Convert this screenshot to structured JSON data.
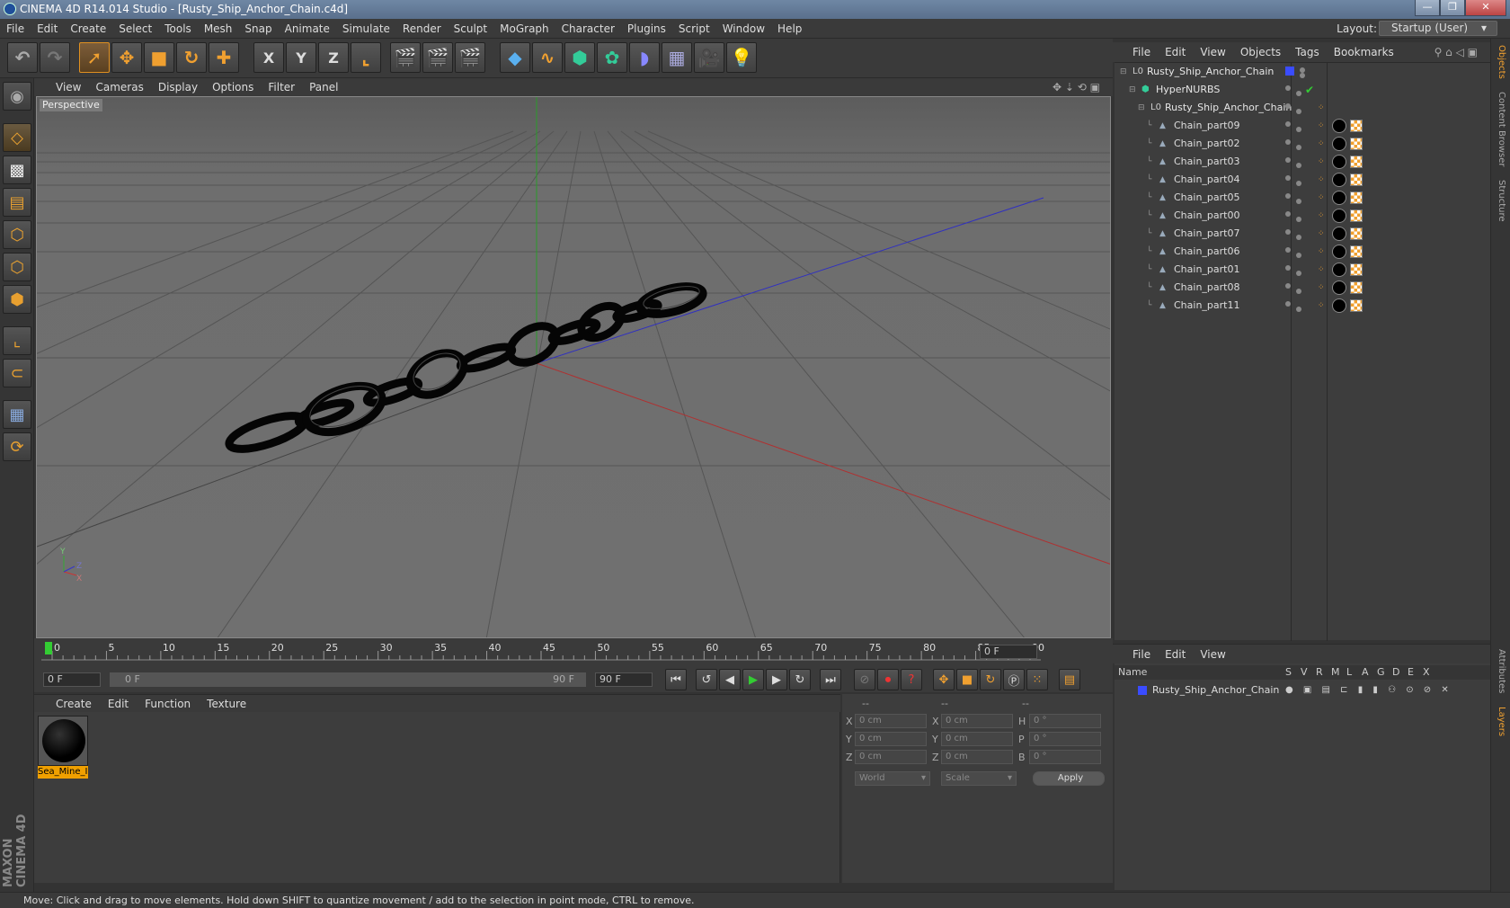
{
  "window": {
    "title": "CINEMA 4D R14.014 Studio - [Rusty_Ship_Anchor_Chain.c4d]",
    "buttons": [
      "—",
      "❐",
      "✕"
    ]
  },
  "menubar": {
    "items": [
      "File",
      "Edit",
      "Create",
      "Select",
      "Tools",
      "Mesh",
      "Snap",
      "Animate",
      "Simulate",
      "Render",
      "Sculpt",
      "MoGraph",
      "Character",
      "Plugins",
      "Script",
      "Window",
      "Help"
    ],
    "layout_label": "Layout:",
    "layout_value": "Startup (User)"
  },
  "toolbar": {
    "axis_x": "X",
    "axis_y": "Y",
    "axis_z": "Z"
  },
  "viewport": {
    "menu": [
      "View",
      "Cameras",
      "Display",
      "Options",
      "Filter",
      "Panel"
    ],
    "label": "Perspective",
    "axis_y": "Y",
    "axis_z": "Z",
    "axis_x": "X"
  },
  "timeline": {
    "ticks": [
      "0",
      "5",
      "10",
      "15",
      "20",
      "25",
      "30",
      "35",
      "40",
      "45",
      "50",
      "55",
      "60",
      "65",
      "70",
      "75",
      "80",
      "85",
      "90"
    ],
    "current_frame": "0 F",
    "start_frame": "0 F",
    "range_start": "0 F",
    "range_end": "90 F",
    "end_frame": "90 F"
  },
  "materials": {
    "menu": [
      "Create",
      "Edit",
      "Function",
      "Texture"
    ],
    "items": [
      {
        "name": "Sea_Mine_I"
      }
    ]
  },
  "coordinates": {
    "headers": [
      "--",
      "--",
      "--"
    ],
    "labels_pos": [
      "X",
      "Y",
      "Z"
    ],
    "labels_size": [
      "X",
      "Y",
      "Z"
    ],
    "labels_rot": [
      "H",
      "P",
      "B"
    ],
    "pos": [
      "0 cm",
      "0 cm",
      "0 cm"
    ],
    "size": [
      "0 cm",
      "0 cm",
      "0 cm"
    ],
    "rot": [
      "0 °",
      "0 °",
      "0 °"
    ],
    "mode": "World",
    "scale": "Scale",
    "apply": "Apply"
  },
  "objects": {
    "menu": [
      "File",
      "Edit",
      "View",
      "Objects",
      "Tags",
      "Bookmarks"
    ],
    "tree": [
      {
        "name": "Rusty_Ship_Anchor_Chain",
        "level": 0
      },
      {
        "name": "HyperNURBS",
        "level": 1
      },
      {
        "name": "Rusty_Ship_Anchor_Chain",
        "level": 2
      },
      {
        "name": "Chain_part09",
        "level": 3
      },
      {
        "name": "Chain_part02",
        "level": 3
      },
      {
        "name": "Chain_part03",
        "level": 3
      },
      {
        "name": "Chain_part04",
        "level": 3
      },
      {
        "name": "Chain_part05",
        "level": 3
      },
      {
        "name": "Chain_part00",
        "level": 3
      },
      {
        "name": "Chain_part07",
        "level": 3
      },
      {
        "name": "Chain_part06",
        "level": 3
      },
      {
        "name": "Chain_part01",
        "level": 3
      },
      {
        "name": "Chain_part08",
        "level": 3
      },
      {
        "name": "Chain_part11",
        "level": 3
      }
    ]
  },
  "layers": {
    "menu": [
      "File",
      "Edit",
      "View"
    ],
    "header_name": "Name",
    "header_cols": [
      "S",
      "V",
      "R",
      "M",
      "L",
      "A",
      "G",
      "D",
      "E",
      "X"
    ],
    "rows": [
      {
        "name": "Rusty_Ship_Anchor_Chain",
        "color": "#3a4cff"
      }
    ]
  },
  "right_tabs": [
    "Objects",
    "Content Browser",
    "Structure",
    "Attributes",
    "Layers"
  ],
  "status": "Move: Click and drag to move elements. Hold down SHIFT to quantize movement / add to the selection in point mode, CTRL to remove.",
  "brand": "MAXON CINEMA 4D",
  "colors": {
    "accent": "#f0a030",
    "axis_x": "#c03030",
    "axis_y": "#30a030",
    "axis_z": "#3030c0"
  }
}
